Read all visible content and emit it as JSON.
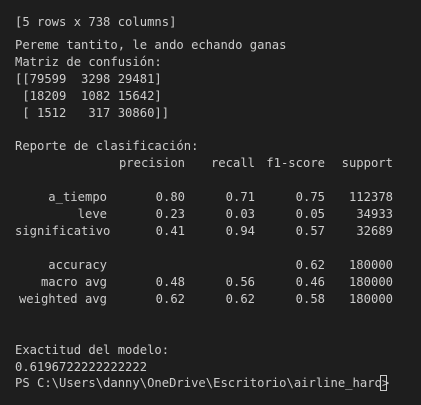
{
  "terminal": {
    "lines": {
      "rows_cols": "[5 rows x 738 columns]",
      "wait_msg": "Pereme tantito, le ando echando ganas",
      "matrix_title": "Matriz de confusión:",
      "matrix_row1": "[[79599  3298 29481]",
      "matrix_row2": " [18209  1082 15642]",
      "matrix_row3": " [ 1512   317 30860]]",
      "report_title": "Reporte de clasificación:",
      "accuracy_title": "Exactitud del modelo:",
      "accuracy_value": "0.6196722222222222",
      "prompt": "PS C:\\Users\\danny\\OneDrive\\Escritorio\\airline_haro> "
    },
    "report": {
      "headers": [
        "precision",
        "recall",
        "f1-score",
        "support"
      ],
      "rows": [
        {
          "label": "a_tiempo",
          "precision": "0.80",
          "recall": "0.71",
          "f1": "0.75",
          "support": "112378"
        },
        {
          "label": "leve",
          "precision": "0.23",
          "recall": "0.03",
          "f1": "0.05",
          "support": "34933"
        },
        {
          "label": "significativo",
          "precision": "0.41",
          "recall": "0.94",
          "f1": "0.57",
          "support": "32689"
        }
      ],
      "summary": [
        {
          "label": "accuracy",
          "precision": "",
          "recall": "",
          "f1": "0.62",
          "support": "180000"
        },
        {
          "label": "macro avg",
          "precision": "0.48",
          "recall": "0.56",
          "f1": "0.46",
          "support": "180000"
        },
        {
          "label": "weighted avg",
          "precision": "0.62",
          "recall": "0.62",
          "f1": "0.58",
          "support": "180000"
        }
      ]
    },
    "colors": {
      "background": "#1e1e1e",
      "text": "#cccccc"
    }
  }
}
